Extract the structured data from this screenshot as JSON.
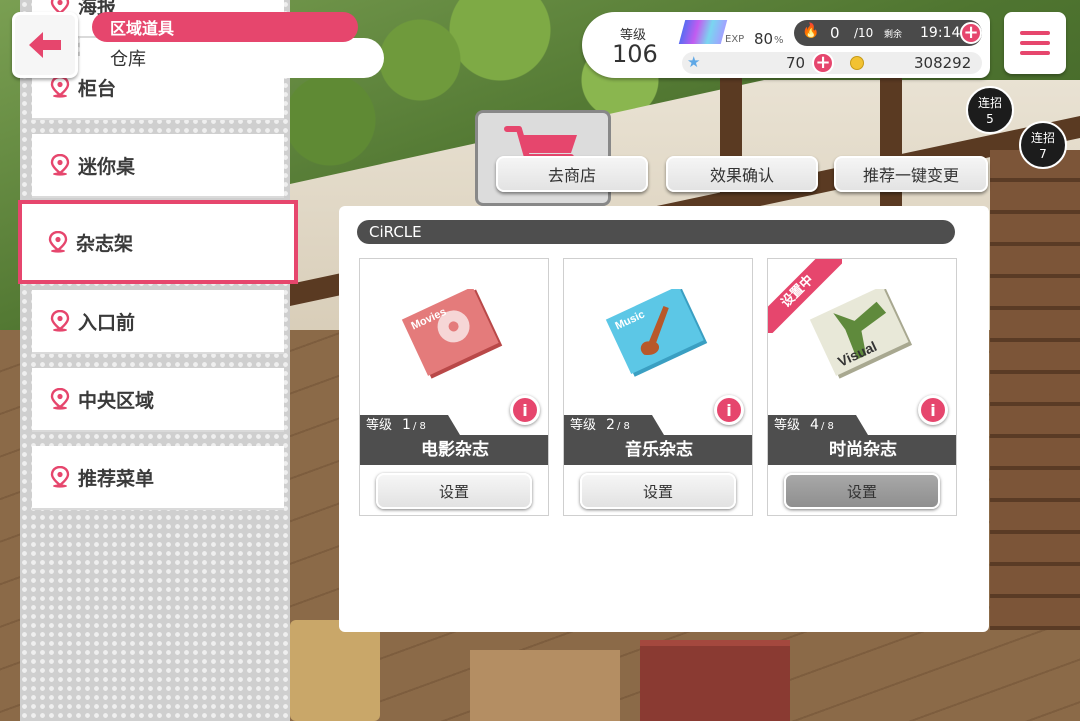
{
  "breadcrumb": {
    "current": "区域道具",
    "parent": "仓库"
  },
  "sidebar": {
    "items": [
      {
        "label": "海报"
      },
      {
        "label": "柜台"
      },
      {
        "label": "迷你桌"
      },
      {
        "label": "杂志架",
        "active": true
      },
      {
        "label": "入口前"
      },
      {
        "label": "中央区域"
      },
      {
        "label": "推荐菜单"
      }
    ]
  },
  "status": {
    "level_label": "等级",
    "level": "106",
    "exp_label": "EXP",
    "exp_value": "80",
    "exp_unit": "%",
    "exp_percent": 80,
    "live_boost": "0",
    "live_boost_max": "/10",
    "remaining_label": "剩余",
    "remaining_time": "19:14",
    "stars": "70",
    "coins": "308292"
  },
  "combos": [
    {
      "label": "连招",
      "count": "5"
    },
    {
      "label": "连招",
      "count": "7"
    }
  ],
  "actions": {
    "shop": "去商店",
    "effect_check": "效果确认",
    "recommend_change": "推荐一键变更"
  },
  "panel": {
    "title": "CiRCLE",
    "cards": [
      {
        "level_label": "等级",
        "level": "1",
        "level_max": "/ 8",
        "name": "电影杂志",
        "button": "设置",
        "installed": false,
        "art_text": "Movies",
        "art_color": "#e47b7b"
      },
      {
        "level_label": "等级",
        "level": "2",
        "level_max": "/ 8",
        "name": "音乐杂志",
        "button": "设置",
        "installed": false,
        "art_text": "Music",
        "art_color": "#5cc7e6"
      },
      {
        "level_label": "等级",
        "level": "4",
        "level_max": "/ 8",
        "name": "时尚杂志",
        "button": "设置",
        "installed": true,
        "ribbon": "设置中",
        "art_text": "Visual",
        "art_color": "#e8e8d8"
      }
    ]
  },
  "colors": {
    "accent": "#e6466d",
    "dark_bar": "#4e4e4e"
  }
}
